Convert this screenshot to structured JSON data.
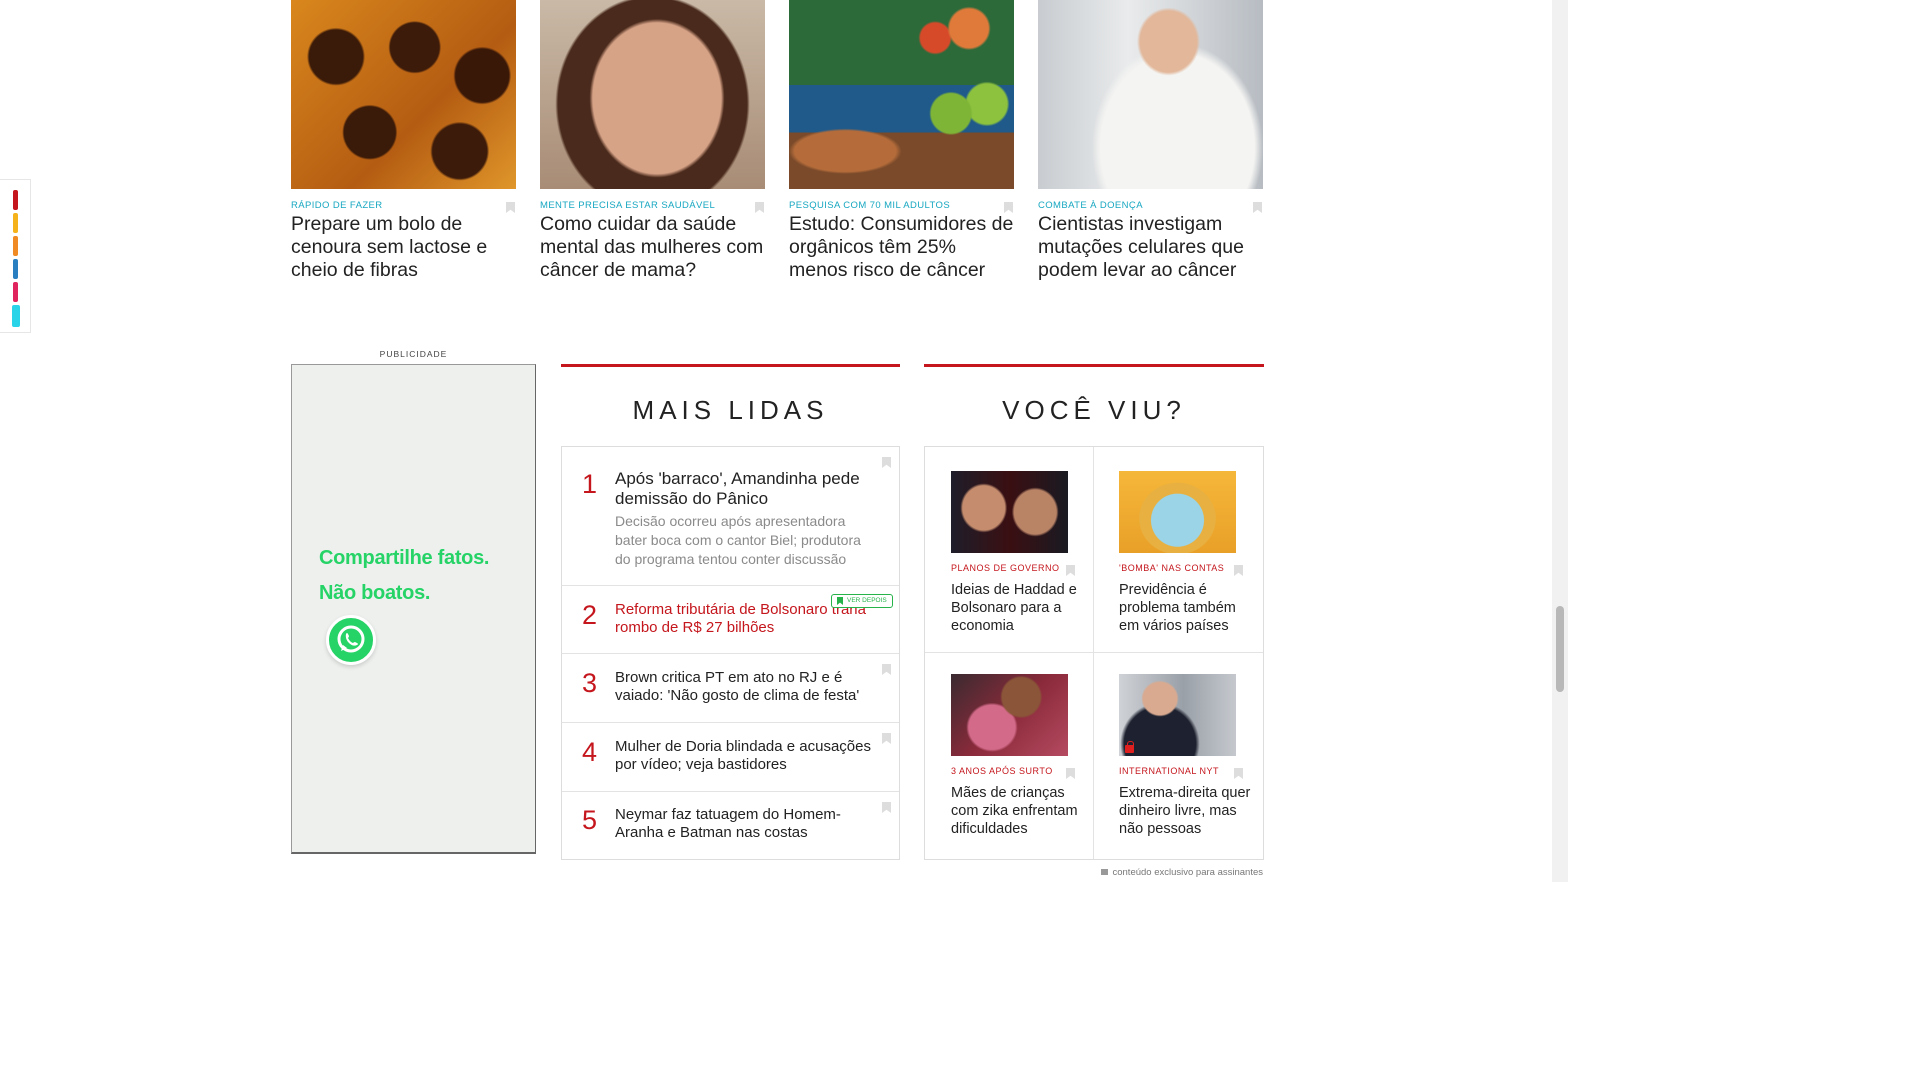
{
  "cards": [
    {
      "kicker": "RÁPIDO DE FAZER",
      "title": "Prepare um bolo de cenoura sem lactose e cheio de fibras"
    },
    {
      "kicker": "MENTE PRECISA ESTAR SAUDÁVEL",
      "title": "Como cuidar da saúde mental das mulheres com câncer de mama?"
    },
    {
      "kicker": "PESQUISA COM 70 MIL ADULTOS",
      "title": "Estudo: Consumidores de orgânicos têm 25% menos risco de câncer"
    },
    {
      "kicker": "COMBATE À DOENÇA",
      "title": "Cientistas investigam mutações celulares que podem levar ao câncer"
    }
  ],
  "ad": {
    "label": "PUBLICIDADE",
    "line1": "Compartilhe fatos.",
    "line2": "Não boatos."
  },
  "mais_lidas": {
    "heading": "MAIS LIDAS",
    "items": [
      {
        "num": "1",
        "title": "Após 'barraco', Amandinha pede demissão do Pânico",
        "desc": "Decisão ocorreu após apresentadora bater boca com o cantor Biel; produtora do programa tentou conter discussão"
      },
      {
        "num": "2",
        "title": "Reforma tributária de Bolsonaro traria rombo de R$ 27 bilhões",
        "badge": "VER DEPOIS"
      },
      {
        "num": "3",
        "title": "Brown critica PT em ato no RJ e é vaiado: 'Não gosto de clima de festa'"
      },
      {
        "num": "4",
        "title": "Mulher de Doria blindada e acusações por vídeo; veja bastidores"
      },
      {
        "num": "5",
        "title": "Neymar faz tatuagem do Homem-Aranha e Batman nas costas"
      }
    ]
  },
  "voce_viu": {
    "heading": "VOCÊ VIU?",
    "items": [
      {
        "kicker": "PLANOS DE GOVERNO",
        "title": "Ideias de Haddad e Bolsonaro para a economia"
      },
      {
        "kicker": "'BOMBA' NAS CONTAS",
        "title": "Previdência é problema também em vários países"
      },
      {
        "kicker": "3 ANOS APÓS SURTO",
        "title": "Mães de crianças com zika enfrentam dificuldades"
      },
      {
        "kicker": "INTERNATIONAL NYT",
        "title": "Extrema-direita quer dinheiro livre, mas não pessoas"
      }
    ]
  },
  "footer_note": "conteúdo exclusivo para assinantes",
  "colors": {
    "accent_red": "#c4161c",
    "kicker_blue": "#17a7c1",
    "whatsapp_green": "#25d366",
    "colorbar": [
      "#c4161c",
      "#f5b21b",
      "#f08a24",
      "#2a7fc1",
      "#e0245e",
      "#2ad4e8"
    ]
  }
}
